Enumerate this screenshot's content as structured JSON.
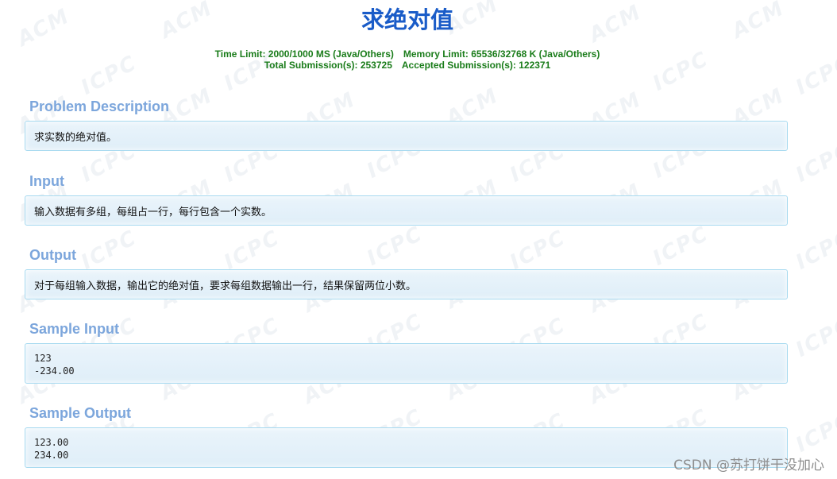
{
  "problem": {
    "title": "求绝对值",
    "time_limit": "Time Limit: 2000/1000 MS (Java/Others)",
    "memory_limit": "Memory Limit: 65536/32768 K (Java/Others)",
    "total_submissions": "Total Submission(s): 253725",
    "accepted_submissions": "Accepted Submission(s): 122371"
  },
  "sections": {
    "description": {
      "heading": "Problem Description",
      "body": "求实数的绝对值。"
    },
    "input": {
      "heading": "Input",
      "body": "输入数据有多组，每组占一行，每行包含一个实数。"
    },
    "output": {
      "heading": "Output",
      "body": "对于每组输入数据，输出它的绝对值，要求每组数据输出一行，结果保留两位小数。"
    },
    "sample_input": {
      "heading": "Sample Input",
      "body": "123\n-234.00"
    },
    "sample_output": {
      "heading": "Sample Output",
      "body": "123.00\n234.00"
    }
  },
  "watermark": {
    "csdn_credit": "CSDN @苏打饼干没加心",
    "background_words": [
      "ACM",
      "ICPC"
    ]
  },
  "colors": {
    "title": "#1a5cc8",
    "limits": "#1a7c1a",
    "section_heading": "#7ca6dc",
    "panel_border": "#a8daf0",
    "panel_background": "#e4f1fa"
  }
}
